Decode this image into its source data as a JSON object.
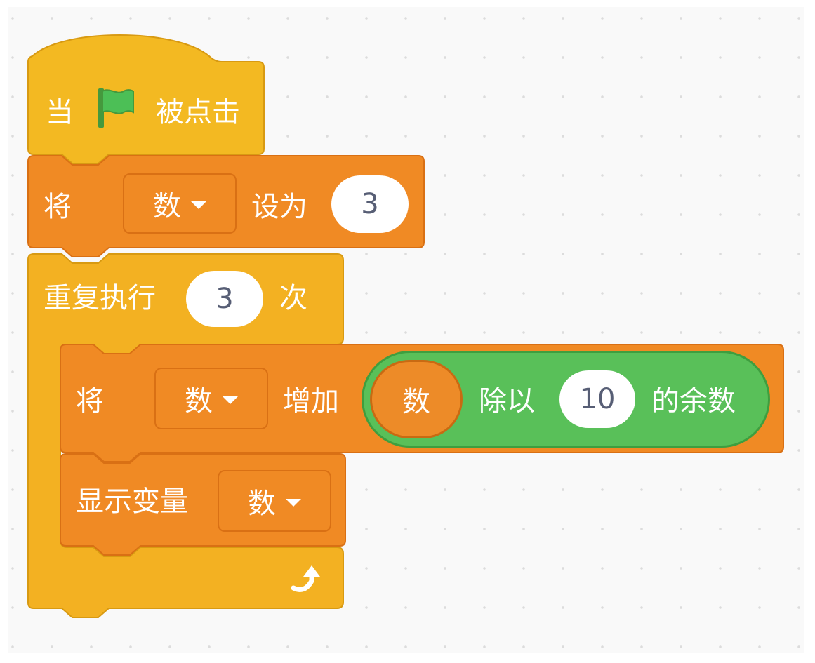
{
  "colors": {
    "events": "#f3b922",
    "control": "#f3b122",
    "variables": "#f08a24",
    "operators": "#59c059",
    "stage_background": "#f9f9f9"
  },
  "hat_block": {
    "prefix": "当",
    "flag_icon": "green-flag-icon",
    "suffix": "被点击"
  },
  "set_block": {
    "prefix": "将",
    "variable": "数",
    "middle": "设为",
    "value": "3"
  },
  "repeat_block": {
    "prefix": "重复执行",
    "count": "3",
    "suffix": "次",
    "loop_icon": "loop-arrow-icon"
  },
  "change_block": {
    "prefix": "将",
    "variable": "数",
    "middle": "增加",
    "mod_reporter": {
      "operand_variable": "数",
      "operator_label": "除以",
      "divisor": "10",
      "suffix": "的余数"
    }
  },
  "show_block": {
    "label": "显示变量",
    "variable": "数"
  }
}
